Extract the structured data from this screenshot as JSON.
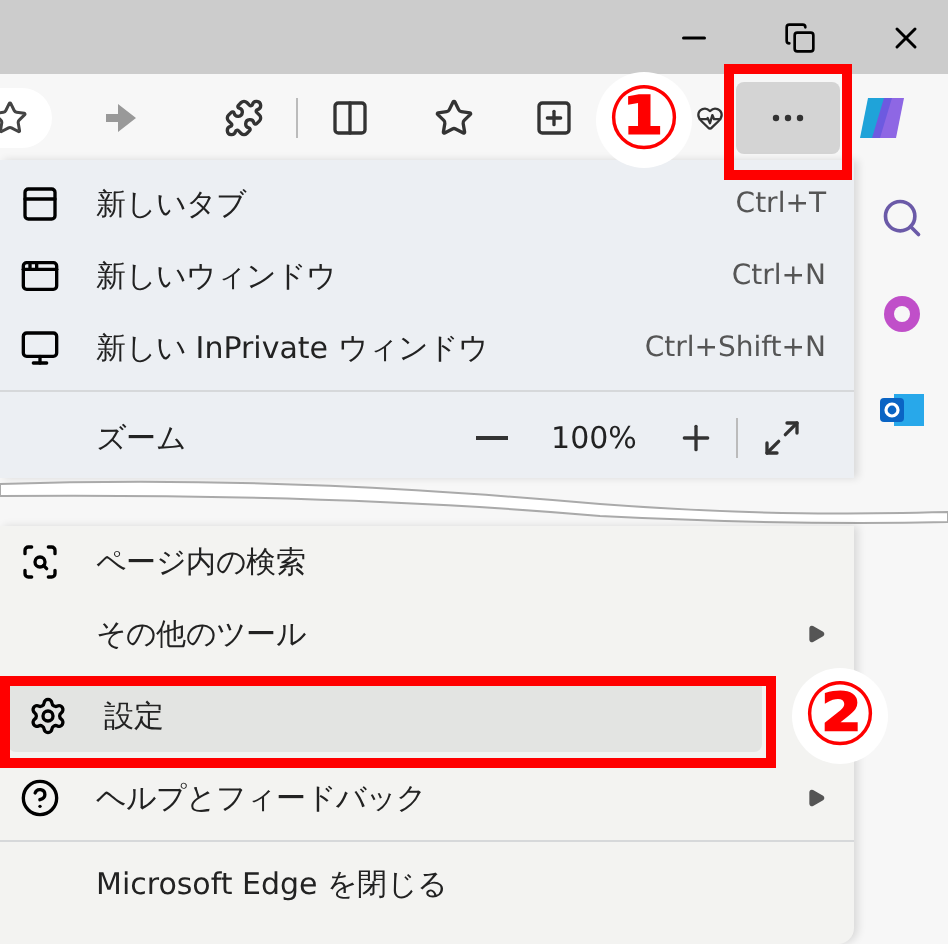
{
  "menu": {
    "items": [
      {
        "kind": "item",
        "label": "新しいタブ",
        "shortcut": "Ctrl+T",
        "submenu": false,
        "selected": false
      },
      {
        "kind": "item",
        "label": "新しいウィンドウ",
        "shortcut": "Ctrl+N",
        "submenu": false,
        "selected": false
      },
      {
        "kind": "item",
        "label": "新しい InPrivate ウィンドウ",
        "shortcut": "Ctrl+Shift+N",
        "submenu": false,
        "selected": false
      },
      {
        "kind": "divider"
      },
      {
        "kind": "zoom",
        "label": "ズーム",
        "value": "100%"
      },
      {
        "kind": "item",
        "label": "ページ内の検索",
        "submenu": false,
        "selected": false
      },
      {
        "kind": "item",
        "label": "その他のツール",
        "submenu": true,
        "selected": false
      },
      {
        "kind": "item",
        "label": "設定",
        "submenu": false,
        "selected": true
      },
      {
        "kind": "item",
        "label": "ヘルプとフィードバック",
        "submenu": true,
        "selected": false
      },
      {
        "kind": "divider"
      },
      {
        "kind": "item",
        "label": "Microsoft Edge を閉じる",
        "submenu": false,
        "selected": false
      }
    ]
  },
  "annotations": [
    {
      "label": "①"
    },
    {
      "label": "②"
    }
  ]
}
